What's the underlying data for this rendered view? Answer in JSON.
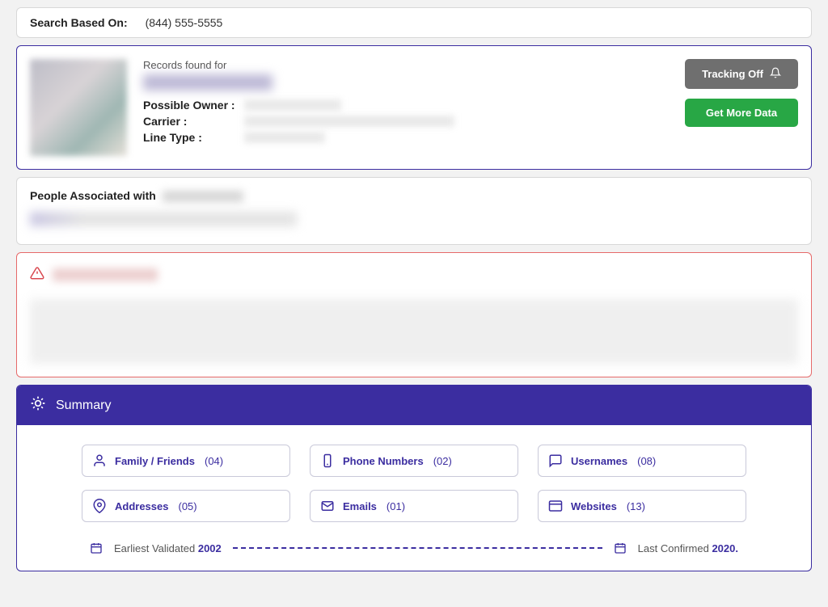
{
  "search": {
    "label": "Search Based On:",
    "value": "(844) 555-5555"
  },
  "profile": {
    "records_label": "Records found for",
    "fields": {
      "owner_label": "Possible Owner :",
      "carrier_label": "Carrier :",
      "linetype_label": "Line Type :"
    },
    "actions": {
      "tracking_label": "Tracking Off",
      "moredata_label": "Get More Data"
    }
  },
  "associated": {
    "title_prefix": "People Associated with"
  },
  "summary": {
    "title": "Summary",
    "items": [
      {
        "icon": "person",
        "label": "Family / Friends",
        "count": "(04)"
      },
      {
        "icon": "phone",
        "label": "Phone Numbers",
        "count": "(02)"
      },
      {
        "icon": "chat",
        "label": "Usernames",
        "count": "(08)"
      },
      {
        "icon": "pin",
        "label": "Addresses",
        "count": "(05)"
      },
      {
        "icon": "mail",
        "label": "Emails",
        "count": "(01)"
      },
      {
        "icon": "web",
        "label": "Websites",
        "count": "(13)"
      }
    ],
    "timeline": {
      "earliest_label": "Earliest Validated",
      "earliest_year": "2002",
      "latest_label": "Last Confirmed",
      "latest_year": "2020."
    }
  }
}
